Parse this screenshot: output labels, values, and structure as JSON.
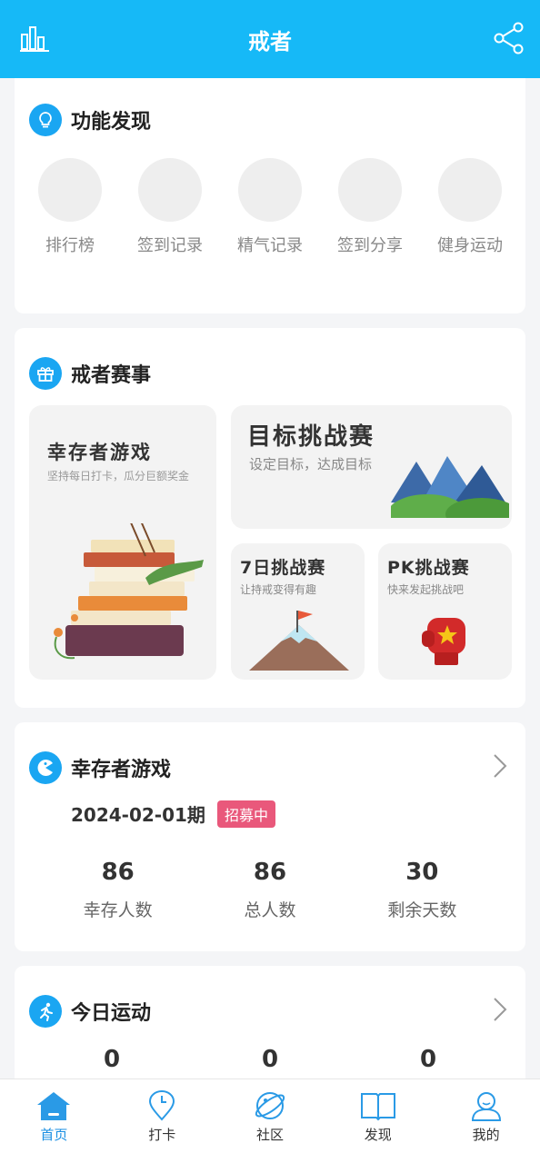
{
  "header": {
    "title": "戒者"
  },
  "features": {
    "title": "功能发现",
    "items": [
      {
        "label": "排行榜"
      },
      {
        "label": "签到记录"
      },
      {
        "label": "精气记录"
      },
      {
        "label": "签到分享"
      },
      {
        "label": "健身运动"
      }
    ]
  },
  "events": {
    "title": "戒者赛事",
    "survivor": {
      "title": "幸存者游戏",
      "subtitle": "坚持每日打卡，瓜分巨额奖金"
    },
    "goal": {
      "title": "目标挑战赛",
      "subtitle": "设定目标，达成目标"
    },
    "seven": {
      "title": "7日挑战赛",
      "subtitle": "让持戒变得有趣"
    },
    "pk": {
      "title": "PK挑战赛",
      "subtitle": "快来发起挑战吧"
    }
  },
  "game": {
    "title": "幸存者游戏",
    "period": "2024-02-01期",
    "badge": "招募中",
    "stats": [
      {
        "value": "86",
        "label": "幸存人数"
      },
      {
        "value": "86",
        "label": "总人数"
      },
      {
        "value": "30",
        "label": "剩余天数"
      }
    ]
  },
  "exercise": {
    "title": "今日运动",
    "values": [
      "0",
      "0",
      "0"
    ]
  },
  "tabs": [
    {
      "label": "首页"
    },
    {
      "label": "打卡"
    },
    {
      "label": "社区"
    },
    {
      "label": "发现"
    },
    {
      "label": "我的"
    }
  ],
  "colors": {
    "primary": "#16b9f7",
    "accent": "#1a8fe3",
    "badge": "#e9587b"
  }
}
